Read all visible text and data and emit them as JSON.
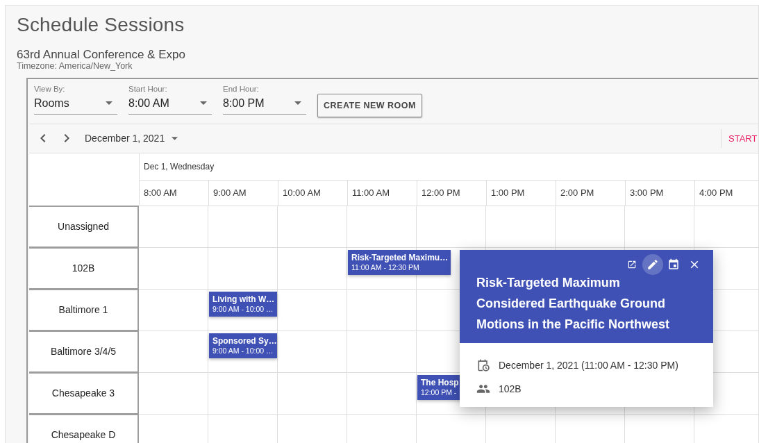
{
  "page": {
    "title": "Schedule Sessions",
    "event_name": "63rd Annual Conference & Expo",
    "timezone": "Timezone: America/New_York"
  },
  "toolbar": {
    "selects": [
      {
        "label": "View By:",
        "value": "Rooms"
      },
      {
        "label": "Start Hour:",
        "value": "8:00 AM"
      },
      {
        "label": "End Hour:",
        "value": "8:00 PM"
      }
    ],
    "button": "CREATE NEW ROOM"
  },
  "nav": {
    "date": "December 1, 2021",
    "action": "START"
  },
  "grid": {
    "day": "Dec 1, Wednesday",
    "times": [
      "8:00 AM",
      "9:00 AM",
      "10:00 AM",
      "11:00 AM",
      "12:00 PM",
      "1:00 PM",
      "2:00 PM",
      "3:00 PM",
      "4:00 PM"
    ],
    "rooms": [
      {
        "name": "Unassigned"
      },
      {
        "name": "102B",
        "sessions": [
          {
            "title": "Risk-Targeted Maximu…",
            "time": "11:00 AM - 12:30 PM"
          }
        ]
      },
      {
        "name": "Baltimore 1",
        "sessions": [
          {
            "title": "Living with W…",
            "time": "9:00 AM - 10:00 …"
          }
        ]
      },
      {
        "name": "Baltimore 3/4/5",
        "sessions": [
          {
            "title": "Sponsored Sy…",
            "time": "9:00 AM - 10:00 …"
          }
        ]
      },
      {
        "name": "Chesapeake 3",
        "sessions": [
          {
            "title": "The Hosp",
            "time": "12:00 PM -"
          }
        ]
      },
      {
        "name": "Chesapeake D"
      }
    ]
  },
  "popup": {
    "actions": [
      {
        "kind": "open",
        "highlighted": false
      },
      {
        "kind": "edit",
        "highlighted": true
      },
      {
        "kind": "calendar",
        "highlighted": false
      },
      {
        "kind": "close",
        "highlighted": false
      }
    ],
    "title": "Risk-Targeted Maximum Considered Earthquake Ground Motions in the Pacific Northwest",
    "details": [
      {
        "kind": "datetime",
        "text": "December 1, 2021 (11:00 AM - 12:30 PM)"
      },
      {
        "kind": "room",
        "text": "102B"
      }
    ]
  }
}
